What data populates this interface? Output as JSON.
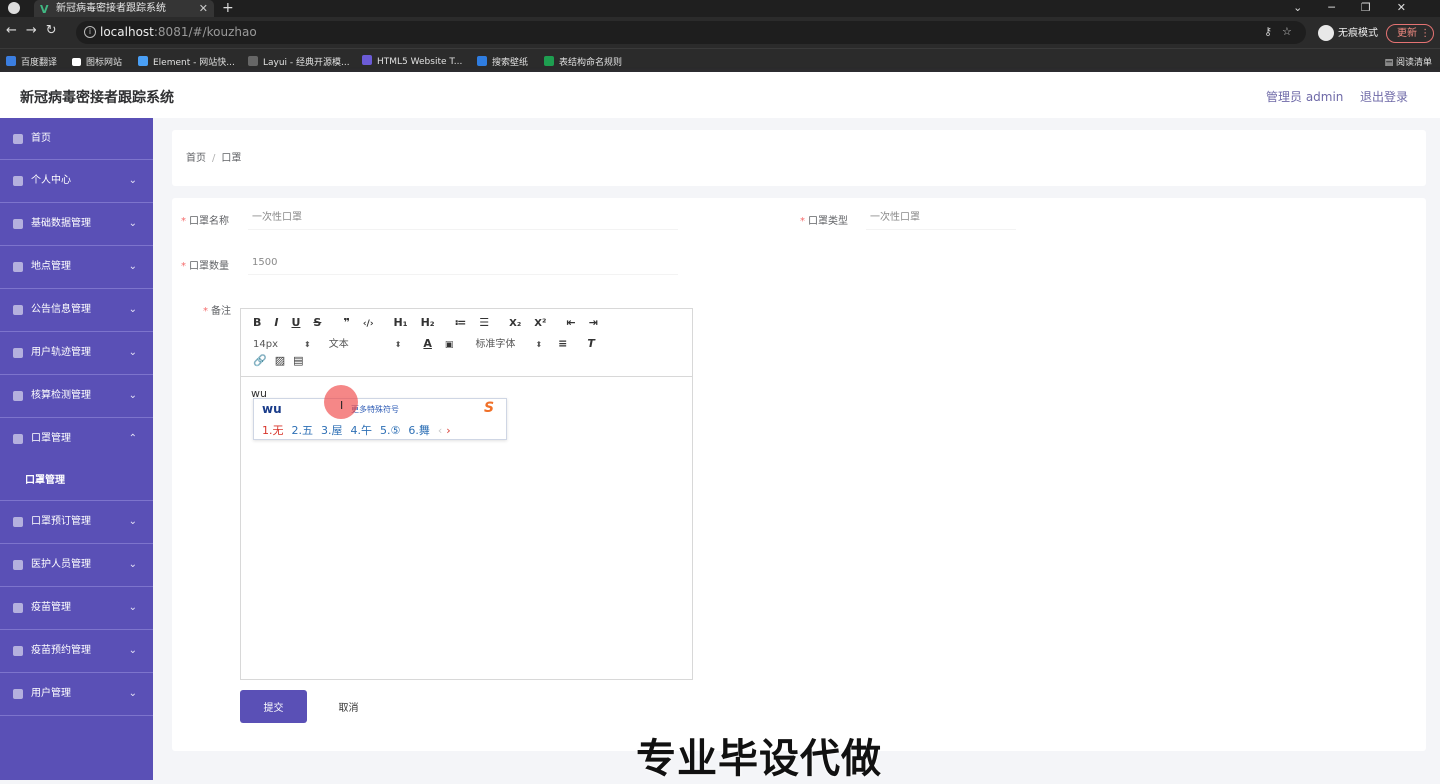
{
  "browser": {
    "tab_title": "新冠病毒密接者跟踪系统",
    "new_tab": "+",
    "url_host": "localhost",
    "url_path": ":8081/#/kouzhao",
    "incognito_label": "无痕模式",
    "update_label": "更新",
    "bookmarks": [
      {
        "label": "百度翻译",
        "color": "#3b7ee0"
      },
      {
        "label": "图标网站",
        "color": "#ffffff"
      },
      {
        "label": "Element - 网站快...",
        "color": "#4a9ff5"
      },
      {
        "label": "Layui - 经典开源模...",
        "color": "#444444"
      },
      {
        "label": "HTML5 Website T...",
        "color": "#6b5bd6"
      },
      {
        "label": "搜索壁纸",
        "color": "#2f7de1"
      },
      {
        "label": "表结构命名规则",
        "color": "#1e9e50"
      }
    ],
    "reading_list": "阅读清单"
  },
  "header": {
    "title": "新冠病毒密接者跟踪系统",
    "admin_label": "管理员 admin",
    "logout_label": "退出登录"
  },
  "sidebar": {
    "items": [
      {
        "label": "首页",
        "chevron": ""
      },
      {
        "label": "个人中心",
        "chevron": "⌄"
      },
      {
        "label": "基础数据管理",
        "chevron": "⌄"
      },
      {
        "label": "地点管理",
        "chevron": "⌄"
      },
      {
        "label": "公告信息管理",
        "chevron": "⌄"
      },
      {
        "label": "用户轨迹管理",
        "chevron": "⌄"
      },
      {
        "label": "核算检测管理",
        "chevron": "⌄"
      },
      {
        "label": "口罩管理",
        "chevron": "⌃"
      },
      {
        "label": "口罩预订管理",
        "chevron": "⌄"
      },
      {
        "label": "医护人员管理",
        "chevron": "⌄"
      },
      {
        "label": "疫苗管理",
        "chevron": "⌄"
      },
      {
        "label": "疫苗预约管理",
        "chevron": "⌄"
      },
      {
        "label": "用户管理",
        "chevron": "⌄"
      }
    ],
    "submenu_label": "口罩管理"
  },
  "breadcrumb": {
    "home": "首页",
    "separator": "/",
    "current": "口罩"
  },
  "form": {
    "name_label": "口罩名称",
    "name_value": "一次性口罩",
    "type_label": "口罩类型",
    "type_value": "一次性口罩",
    "qty_label": "口罩数量",
    "qty_value": "1500",
    "remark_label": "备注",
    "required_mark": "*",
    "submit_label": "提交",
    "cancel_label": "取消"
  },
  "editor": {
    "row1": [
      "B",
      "I",
      "U",
      "S",
      "❞",
      "‹/›",
      "H₁",
      "H₂",
      "≔",
      "☰",
      "X₂",
      "X²",
      "⇤",
      "⇥"
    ],
    "font_size": "14px",
    "style": "文本",
    "font_family": "标准字体",
    "content": "wu"
  },
  "ime": {
    "composition": "wu",
    "more_symbols": "更多特殊符号",
    "candidates": [
      "1.无",
      "2.五",
      "3.屋",
      "4.午",
      "5.⑤",
      "6.舞"
    ],
    "page_prev": "‹",
    "page_next": "›"
  },
  "overlay": {
    "watermark": "专业毕设代做"
  }
}
